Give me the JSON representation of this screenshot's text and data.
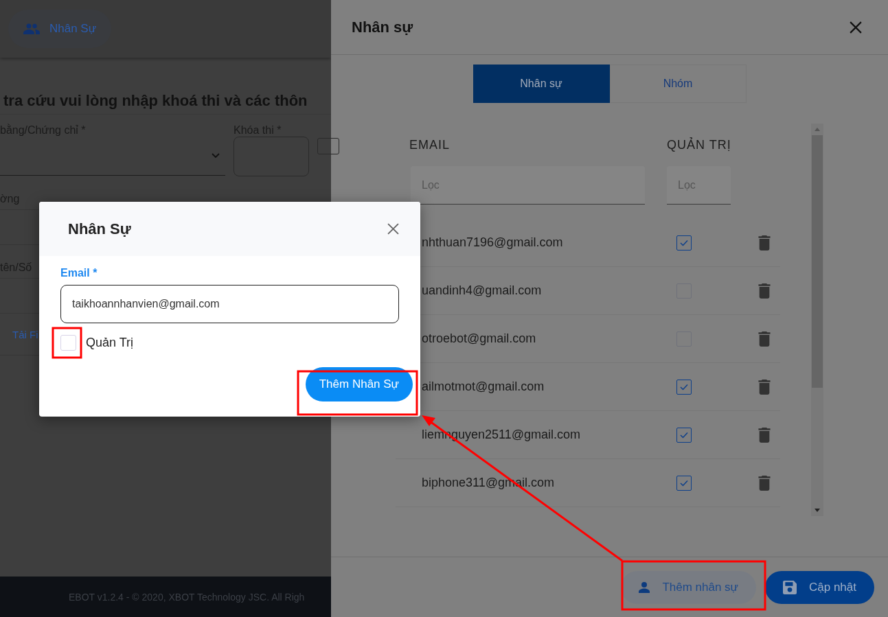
{
  "page": {
    "nav_button": "Nhân Sự",
    "heading": "tra cứu vui lòng nhập khoá thi và các thôn",
    "fields": [
      {
        "label": "bằng/Chứng chỉ *",
        "kind": "select"
      },
      {
        "label": "Khóa thi *",
        "kind": "input"
      }
    ],
    "labels": [
      "ờng",
      "tên/Số"
    ],
    "link": "Tải Fi",
    "footer": "EBOT v1.2.4 - © 2020, XBOT Technology JSC. All Righ"
  },
  "drawer": {
    "title": "Nhân sự",
    "tabs": [
      {
        "label": "Nhân sự",
        "selected": true
      },
      {
        "label": "Nhóm",
        "selected": false
      }
    ],
    "columns": [
      "EMAIL",
      "QUẢN TRỊ"
    ],
    "filters": [
      {
        "placeholder": "Lọc"
      },
      {
        "placeholder": "Lọc"
      }
    ],
    "rows": [
      {
        "email": "nhthuan7196@gmail.com",
        "admin": true
      },
      {
        "email": "uandinh4@gmail.com",
        "admin": false
      },
      {
        "email": "otroebot@gmail.com",
        "admin": false
      },
      {
        "email": "ailmotmot@gmail.com",
        "admin": true
      },
      {
        "email": "liemnguyen2511@gmail.com",
        "admin": true
      },
      {
        "email": "biphone311@gmail.com",
        "admin": true
      }
    ],
    "buttons": [
      {
        "label": "Thêm nhân sự",
        "kind": "secondary"
      },
      {
        "label": "Cập nhật",
        "kind": "primary"
      }
    ]
  },
  "dialog": {
    "title": "Nhân Sự",
    "field": {
      "label": "Email *",
      "value": "taikhoannhanvien@gmail.com"
    },
    "checkbox": {
      "label": "Quản Trị",
      "checked": false
    },
    "button": "Thêm Nhân Sự"
  }
}
